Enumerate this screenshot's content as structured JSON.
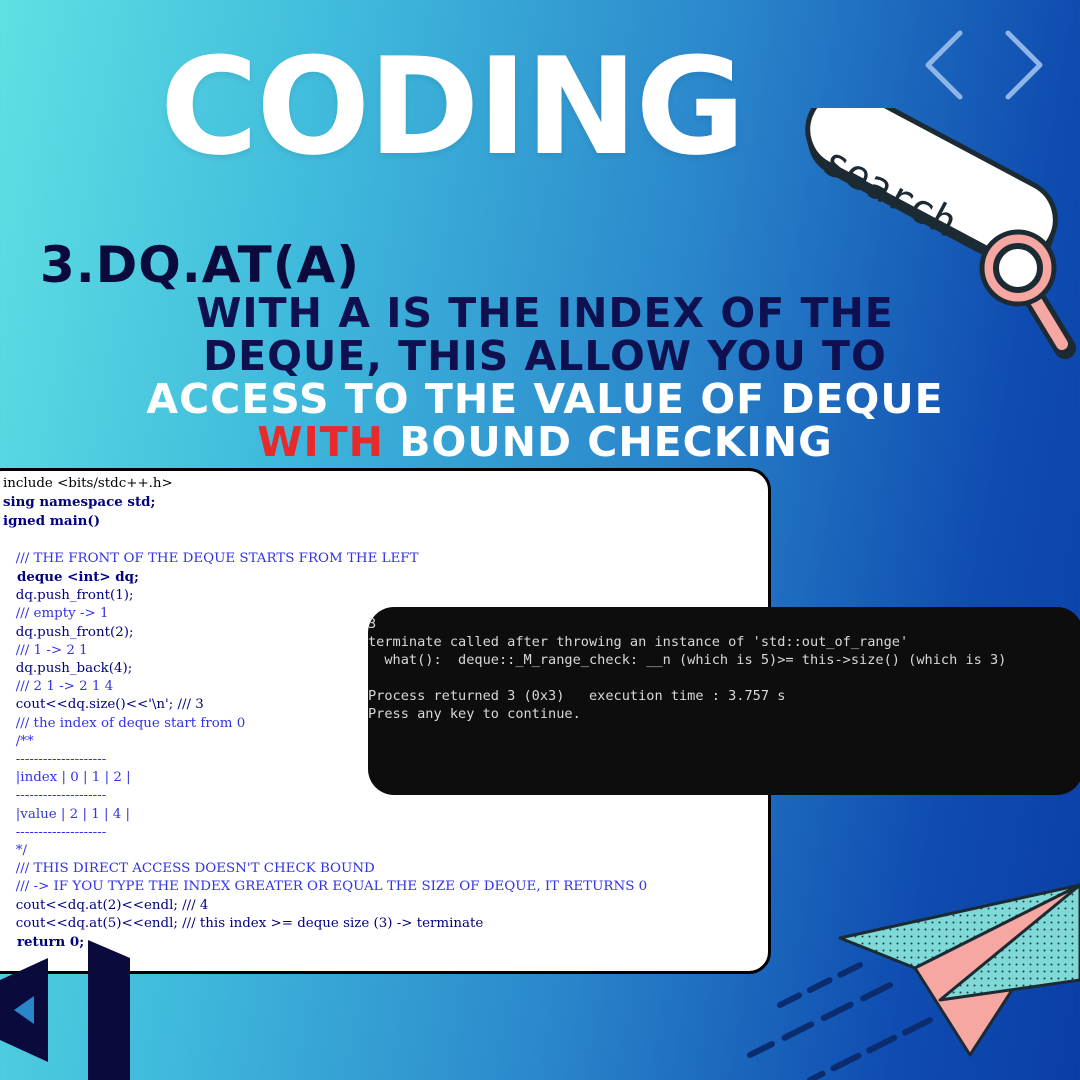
{
  "title": "CODING",
  "subtitle": "3.DQ.AT(A)",
  "description": {
    "part1": "WITH A IS THE INDEX OF THE DEQUE, THIS ALLOW YOU TO ",
    "part2": "ACCESS TO THE VALUE OF DEQUE ",
    "part3": "WITH",
    "part4": " BOUND CHECKING"
  },
  "search_label": "search",
  "code_lines": [
    "include <bits/stdc++.h>",
    "sing namespace std;",
    "igned main()",
    "",
    "   /// THE FRONT OF THE DEQUE STARTS FROM THE LEFT",
    "   deque <int> dq;",
    "   dq.push_front(1);",
    "   /// empty -> 1",
    "   dq.push_front(2);",
    "   /// 1 -> 2 1",
    "   dq.push_back(4);",
    "   /// 2 1 -> 2 1 4",
    "   cout<<dq.size()<<'\\n'; /// 3",
    "   /// the index of deque start from 0",
    "   /**",
    "   --------------------",
    "   |index | 0 | 1 | 2 |",
    "   --------------------",
    "   |value | 2 | 1 | 4 |",
    "   --------------------",
    "   */",
    "   /// THIS DIRECT ACCESS DOESN'T CHECK BOUND",
    "   /// -> IF YOU TYPE THE INDEX GREATER OR EQUAL THE SIZE OF DEQUE, IT RETURNS 0",
    "   cout<<dq.at(2)<<endl; /// 4",
    "   cout<<dq.at(5)<<endl; /// this index >= deque size (3) -> terminate",
    "   return 0;"
  ],
  "console_lines": [
    "3",
    "terminate called after throwing an instance of 'std::out_of_range'",
    "  what():  deque::_M_range_check: __n (which is 5)>= this->size() (which is 3)",
    "",
    "Process returned 3 (0x3)   execution time : 3.757 s",
    "Press any key to continue."
  ],
  "icons": {
    "nav": "chevron-left-right-icon",
    "search": "magnifier-icon",
    "plane": "paper-plane-icon",
    "logo": "visual-studio-logo-icon"
  },
  "colors": {
    "title": "#ffffff",
    "subtitle": "#0a0a3c",
    "accent_red": "#e82a2a",
    "console_bg": "#0d0d0d"
  }
}
